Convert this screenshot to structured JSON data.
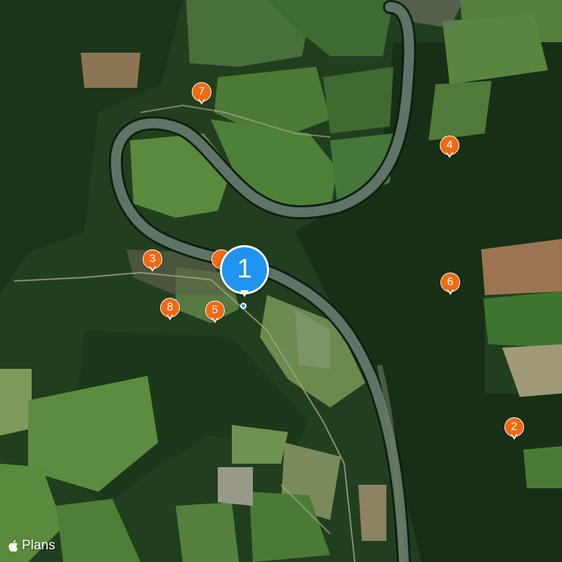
{
  "map": {
    "view": "satellite",
    "attribution_text": "Plans",
    "attribution_logo": "apple-logo-icon",
    "colors": {
      "marker_orange": "#f06a13",
      "marker_selected_blue": "#1e94f0",
      "river": "#5f7466",
      "forest": "#1d3a1b",
      "field_green": "#4a7a34",
      "field_brown": "#9a7350"
    }
  },
  "selected_marker": {
    "label": "1"
  },
  "markers": [
    {
      "label": "2"
    },
    {
      "label": "3"
    },
    {
      "label": "4"
    },
    {
      "label": "5"
    },
    {
      "label": "6"
    },
    {
      "label": "7"
    },
    {
      "label": "8"
    }
  ]
}
